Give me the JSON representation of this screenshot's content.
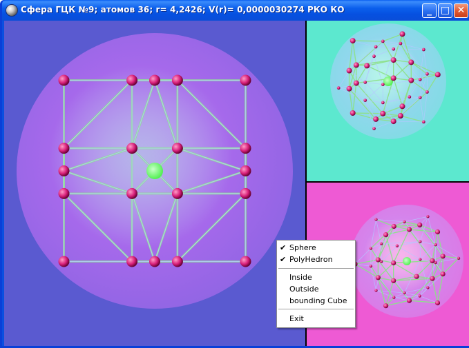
{
  "window": {
    "title": "Сфера ГЦК №9; атомов 36; r= 4,2426; V(r)= 0,0000030274 РКО КО",
    "icon": "app-sphere-icon",
    "controls": {
      "minimize": "_",
      "maximize": "□",
      "close": "✕"
    }
  },
  "viewports": [
    {
      "name": "main-view",
      "background": "#5a5ad0",
      "sphere_color": "#b36cf0"
    },
    {
      "name": "top-right-view",
      "background": "#5ce8cf",
      "sphere_color": "#9ad4f2"
    },
    {
      "name": "bottom-right-view",
      "background": "#ee5ad4",
      "sphere_color": "#d08cf0"
    }
  ],
  "context_menu": {
    "items": [
      {
        "label": "Sphere",
        "checked": true,
        "check_mark": "✔"
      },
      {
        "label": "PolyHedron",
        "checked": true,
        "check_mark": "✔"
      },
      {
        "separator": true
      },
      {
        "label": "Inside",
        "checked": false
      },
      {
        "label": "Outside",
        "checked": false
      },
      {
        "label": "bounding Cube",
        "checked": false
      },
      {
        "separator": true
      },
      {
        "label": "Exit",
        "checked": false
      }
    ]
  },
  "colors": {
    "frame": "#0a4fe0",
    "edge_green": "#8ee08a",
    "edge_blue": "#b4c8ff",
    "atom": "#d8207a",
    "center_atom": "#52f052"
  }
}
